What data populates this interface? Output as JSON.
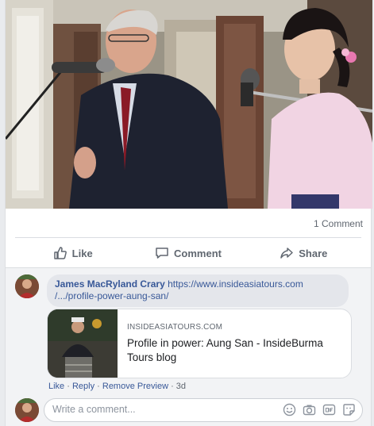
{
  "post": {
    "comment_count": "1 Comment",
    "actions": {
      "like": "Like",
      "comment": "Comment",
      "share": "Share"
    }
  },
  "comment": {
    "author": "James MacRyland Crary",
    "link_line1": "https://www.insideasiatours.com",
    "link_line2": "/.../profile-power-aung-san/",
    "preview": {
      "domain": "INSIDEASIATOURS.COM",
      "title": "Profile in power: Aung San - InsideBurma Tours blog"
    },
    "meta": {
      "like": "Like",
      "reply": "Reply",
      "remove_preview": "Remove Preview",
      "age": "3d"
    }
  },
  "composer": {
    "placeholder": "Write a comment..."
  },
  "icons": {
    "like": "thumbs-up-icon",
    "comment": "speech-bubble-icon",
    "share": "share-arrow-icon",
    "emoji": "emoji-icon",
    "camera": "camera-icon",
    "gif": "gif-icon",
    "sticker": "sticker-icon"
  },
  "colors": {
    "link": "#385898",
    "muted": "#606770",
    "bubble": "#e4e6eb"
  }
}
